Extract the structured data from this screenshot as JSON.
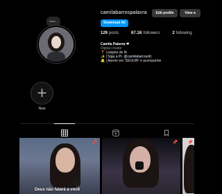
{
  "profile": {
    "username": "camilabarrospalavra",
    "note": "Note...",
    "buttons": {
      "edit": "Edit profile",
      "view": "View a"
    },
    "download": "Download All"
  },
  "stats": {
    "posts_value": "129",
    "posts_label": "posts",
    "followers_value": "67.1K",
    "followers_label": "followers",
    "following_value": "2",
    "following_label": "following"
  },
  "bio": {
    "name": "Camila Palavra ❤",
    "category": "Digital creator",
    "line1": "📍 | página de fã",
    "line2": "✨ | Siga a Pr. @camilabarrosofc",
    "line3": "🔔 | Aperte em 'SEGUIR' e acompanhe"
  },
  "highlights": [
    {
      "label": "New"
    }
  ],
  "tabs": [
    {
      "icon": "grid-icon"
    },
    {
      "icon": "reels-icon"
    },
    {
      "icon": "saved-icon"
    }
  ],
  "posts": [
    {
      "caption": "Deus não falará a você",
      "pinned": true
    },
    {
      "caption": "",
      "pinned": true
    },
    {
      "caption": "",
      "pinned": true
    }
  ]
}
